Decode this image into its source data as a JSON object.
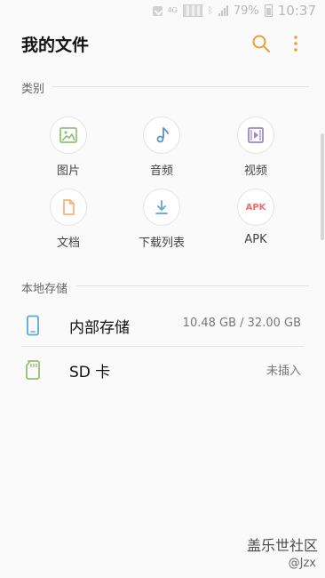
{
  "status_bar": {
    "network_label": "4G",
    "battery_text": "79%",
    "time": "10:37"
  },
  "header": {
    "title": "我的文件",
    "icons": {
      "search": "search-icon",
      "more": "more-vert-icon"
    }
  },
  "sections": {
    "categories_label": "类别",
    "storage_label": "本地存储"
  },
  "categories": [
    {
      "label": "图片",
      "icon": "image-icon"
    },
    {
      "label": "音频",
      "icon": "music-note-icon"
    },
    {
      "label": "视频",
      "icon": "video-icon"
    },
    {
      "label": "文档",
      "icon": "document-icon"
    },
    {
      "label": "下载列表",
      "icon": "download-icon"
    },
    {
      "label": "APK",
      "icon": "apk-icon",
      "icon_text": "APK"
    }
  ],
  "storage": [
    {
      "name": "内部存储",
      "value": "10.48 GB / 32.00 GB",
      "icon": "phone-icon"
    },
    {
      "name": "SD 卡",
      "value": "未插入",
      "icon": "sd-card-icon"
    }
  ],
  "watermark": {
    "brand": "盖乐世社区",
    "handle": "@Jzx"
  },
  "colors": {
    "background": "#fafafa",
    "accent_orange": "#e2a236",
    "icon_green": "#93c47d",
    "icon_blue": "#5a91c7",
    "icon_purple": "#9b88cf",
    "icon_orange": "#f3b57d",
    "icon_red": "#f06b6b",
    "storage_blue": "#5ea7d7",
    "storage_green": "#9bbd72"
  }
}
